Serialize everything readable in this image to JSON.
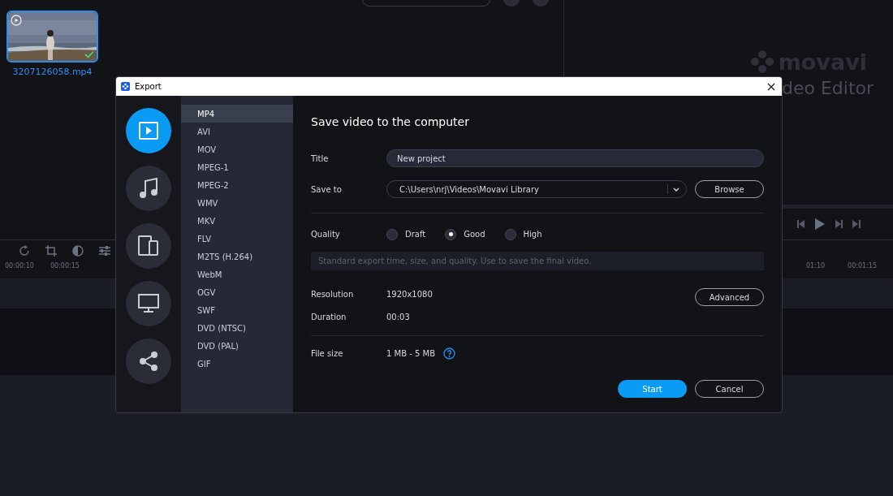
{
  "media": {
    "filename": "3207126058.mp4",
    "checked": true
  },
  "brand": {
    "product": "movavi",
    "edition": "deo Editor"
  },
  "timeline": {
    "left_ticks": [
      "00:00:10",
      "00:00:15"
    ],
    "right_ticks": [
      "01:10",
      "00:01:15"
    ]
  },
  "dialog": {
    "title": "Export",
    "categories": [
      {
        "kind": "video",
        "selected": true
      },
      {
        "kind": "audio",
        "selected": false
      },
      {
        "kind": "devices",
        "selected": false
      },
      {
        "kind": "tv",
        "selected": false
      },
      {
        "kind": "share",
        "selected": false
      }
    ],
    "formats": [
      {
        "label": "MP4",
        "selected": true
      },
      {
        "label": "AVI",
        "selected": false
      },
      {
        "label": "MOV",
        "selected": false
      },
      {
        "label": "MPEG-1",
        "selected": false
      },
      {
        "label": "MPEG-2",
        "selected": false
      },
      {
        "label": "WMV",
        "selected": false
      },
      {
        "label": "MKV",
        "selected": false
      },
      {
        "label": "FLV",
        "selected": false
      },
      {
        "label": "M2TS (H.264)",
        "selected": false
      },
      {
        "label": "WebM",
        "selected": false
      },
      {
        "label": "OGV",
        "selected": false
      },
      {
        "label": "SWF",
        "selected": false
      },
      {
        "label": "DVD (NTSC)",
        "selected": false
      },
      {
        "label": "DVD (PAL)",
        "selected": false
      },
      {
        "label": "GIF",
        "selected": false
      }
    ],
    "heading": "Save video to the computer",
    "title_label": "Title",
    "title_value": "New project",
    "save_label": "Save to",
    "save_value": "C:\\Users\\nrj\\Videos\\Movavi Library",
    "browse": "Browse",
    "quality_label": "Quality",
    "quality_options": [
      {
        "label": "Draft",
        "selected": false
      },
      {
        "label": "Good",
        "selected": true
      },
      {
        "label": "High",
        "selected": false
      }
    ],
    "description": "Standard export time, size, and quality. Use to save the final video.",
    "resolution_label": "Resolution",
    "resolution": "1920x1080",
    "advanced": "Advanced",
    "duration_label": "Duration",
    "duration": "00:03",
    "filesize_label": "File size",
    "filesize": "1 MB - 5 MB",
    "start": "Start",
    "cancel": "Cancel"
  }
}
